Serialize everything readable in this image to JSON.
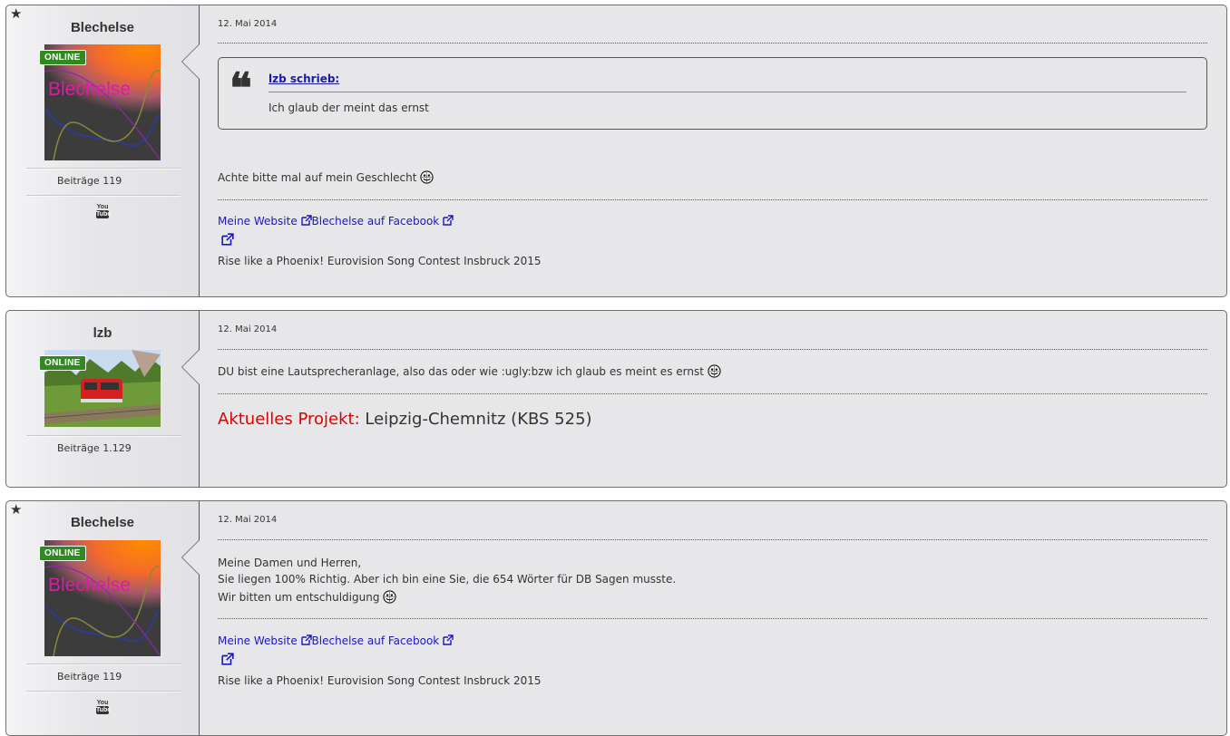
{
  "posts": [
    {
      "username": "Blechelse",
      "online": "ONLINE",
      "avatar_text": "Blechelse",
      "stat_label": "Beiträge",
      "stat_value": "119",
      "social_icon": "youtube-icon",
      "starred": true,
      "date": "12. Mai 2014",
      "quote": {
        "author": "lzb schrieb:",
        "text": "Ich glaub der meint das ernst"
      },
      "message": "Achte bitte mal auf mein Geschlecht",
      "signature": {
        "link1": "Meine Website",
        "link2": "Blechelse auf Facebook",
        "text": "Rise like a Phoenix! Eurovision Song Contest Insbruck 2015"
      }
    },
    {
      "username": "lzb",
      "online": "ONLINE",
      "stat_label": "Beiträge",
      "stat_value": "1.129",
      "starred": false,
      "date": "12. Mai 2014",
      "message": "DU bist eine Lautsprecheranlage, also das oder wie :ugly:bzw ich glaub es meint es ernst",
      "signature": {
        "project_label": "Aktuelles Projekt:",
        "project_value": "Leipzig-Chemnitz (KBS 525)"
      }
    },
    {
      "username": "Blechelse",
      "online": "ONLINE",
      "avatar_text": "Blechelse",
      "stat_label": "Beiträge",
      "stat_value": "119",
      "social_icon": "youtube-icon",
      "starred": true,
      "date": "12. Mai 2014",
      "message_lines": [
        "Meine Damen und Herren,",
        "Sie liegen 100% Richtig. Aber ich bin eine Sie, die 654 Wörter für DB Sagen musste.",
        "Wir bitten um entschuldigung"
      ],
      "signature": {
        "link1": "Meine Website",
        "link2": "Blechelse auf Facebook",
        "text": "Rise like a Phoenix! Eurovision Song Contest Insbruck 2015"
      }
    }
  ],
  "colors": {
    "post_bg": "#e7e7ea",
    "online_badge": "#2e8b1e",
    "link": "#1717c6",
    "project_label": "#e00000"
  }
}
